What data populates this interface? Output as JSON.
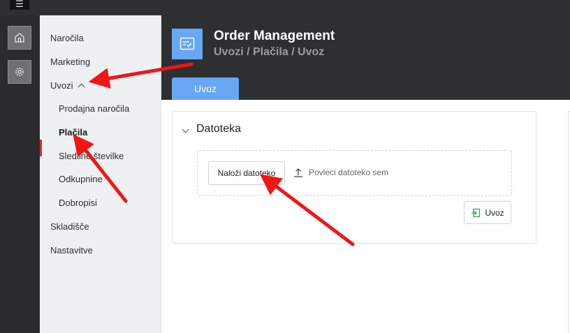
{
  "topbar": {
    "menu_icon": "hamburger-icon"
  },
  "rail": {
    "items": [
      {
        "icon": "home-icon"
      },
      {
        "icon": "gear-icon"
      }
    ]
  },
  "sidebar": {
    "items": [
      {
        "label": "Naročila"
      },
      {
        "label": "Marketing"
      },
      {
        "label": "Uvozi",
        "expanded": true
      },
      {
        "label": "Prodajna naročila"
      },
      {
        "label": "Plačila",
        "active": true
      },
      {
        "label": "Sledilne številke"
      },
      {
        "label": "Odkupnine"
      },
      {
        "label": "Dobropisi"
      },
      {
        "label": "Skladišče"
      },
      {
        "label": "Nastavitve"
      }
    ]
  },
  "header": {
    "icon": "checklist-icon",
    "title": "Order Management",
    "breadcrumb": "Uvozi / Plačila / Uvoz",
    "tabs": [
      {
        "label": "Uvoz",
        "active": true
      }
    ]
  },
  "card": {
    "title": "Datoteka",
    "upload_button": "Naloži datoteko",
    "drop_hint": "Povleci datoteko sem",
    "import_button": "Uvoz"
  },
  "colors": {
    "accent": "#67a7f4",
    "dark": "#2e2f31",
    "active_marker": "#e0282a",
    "annotation_arrow": "#f01616"
  }
}
